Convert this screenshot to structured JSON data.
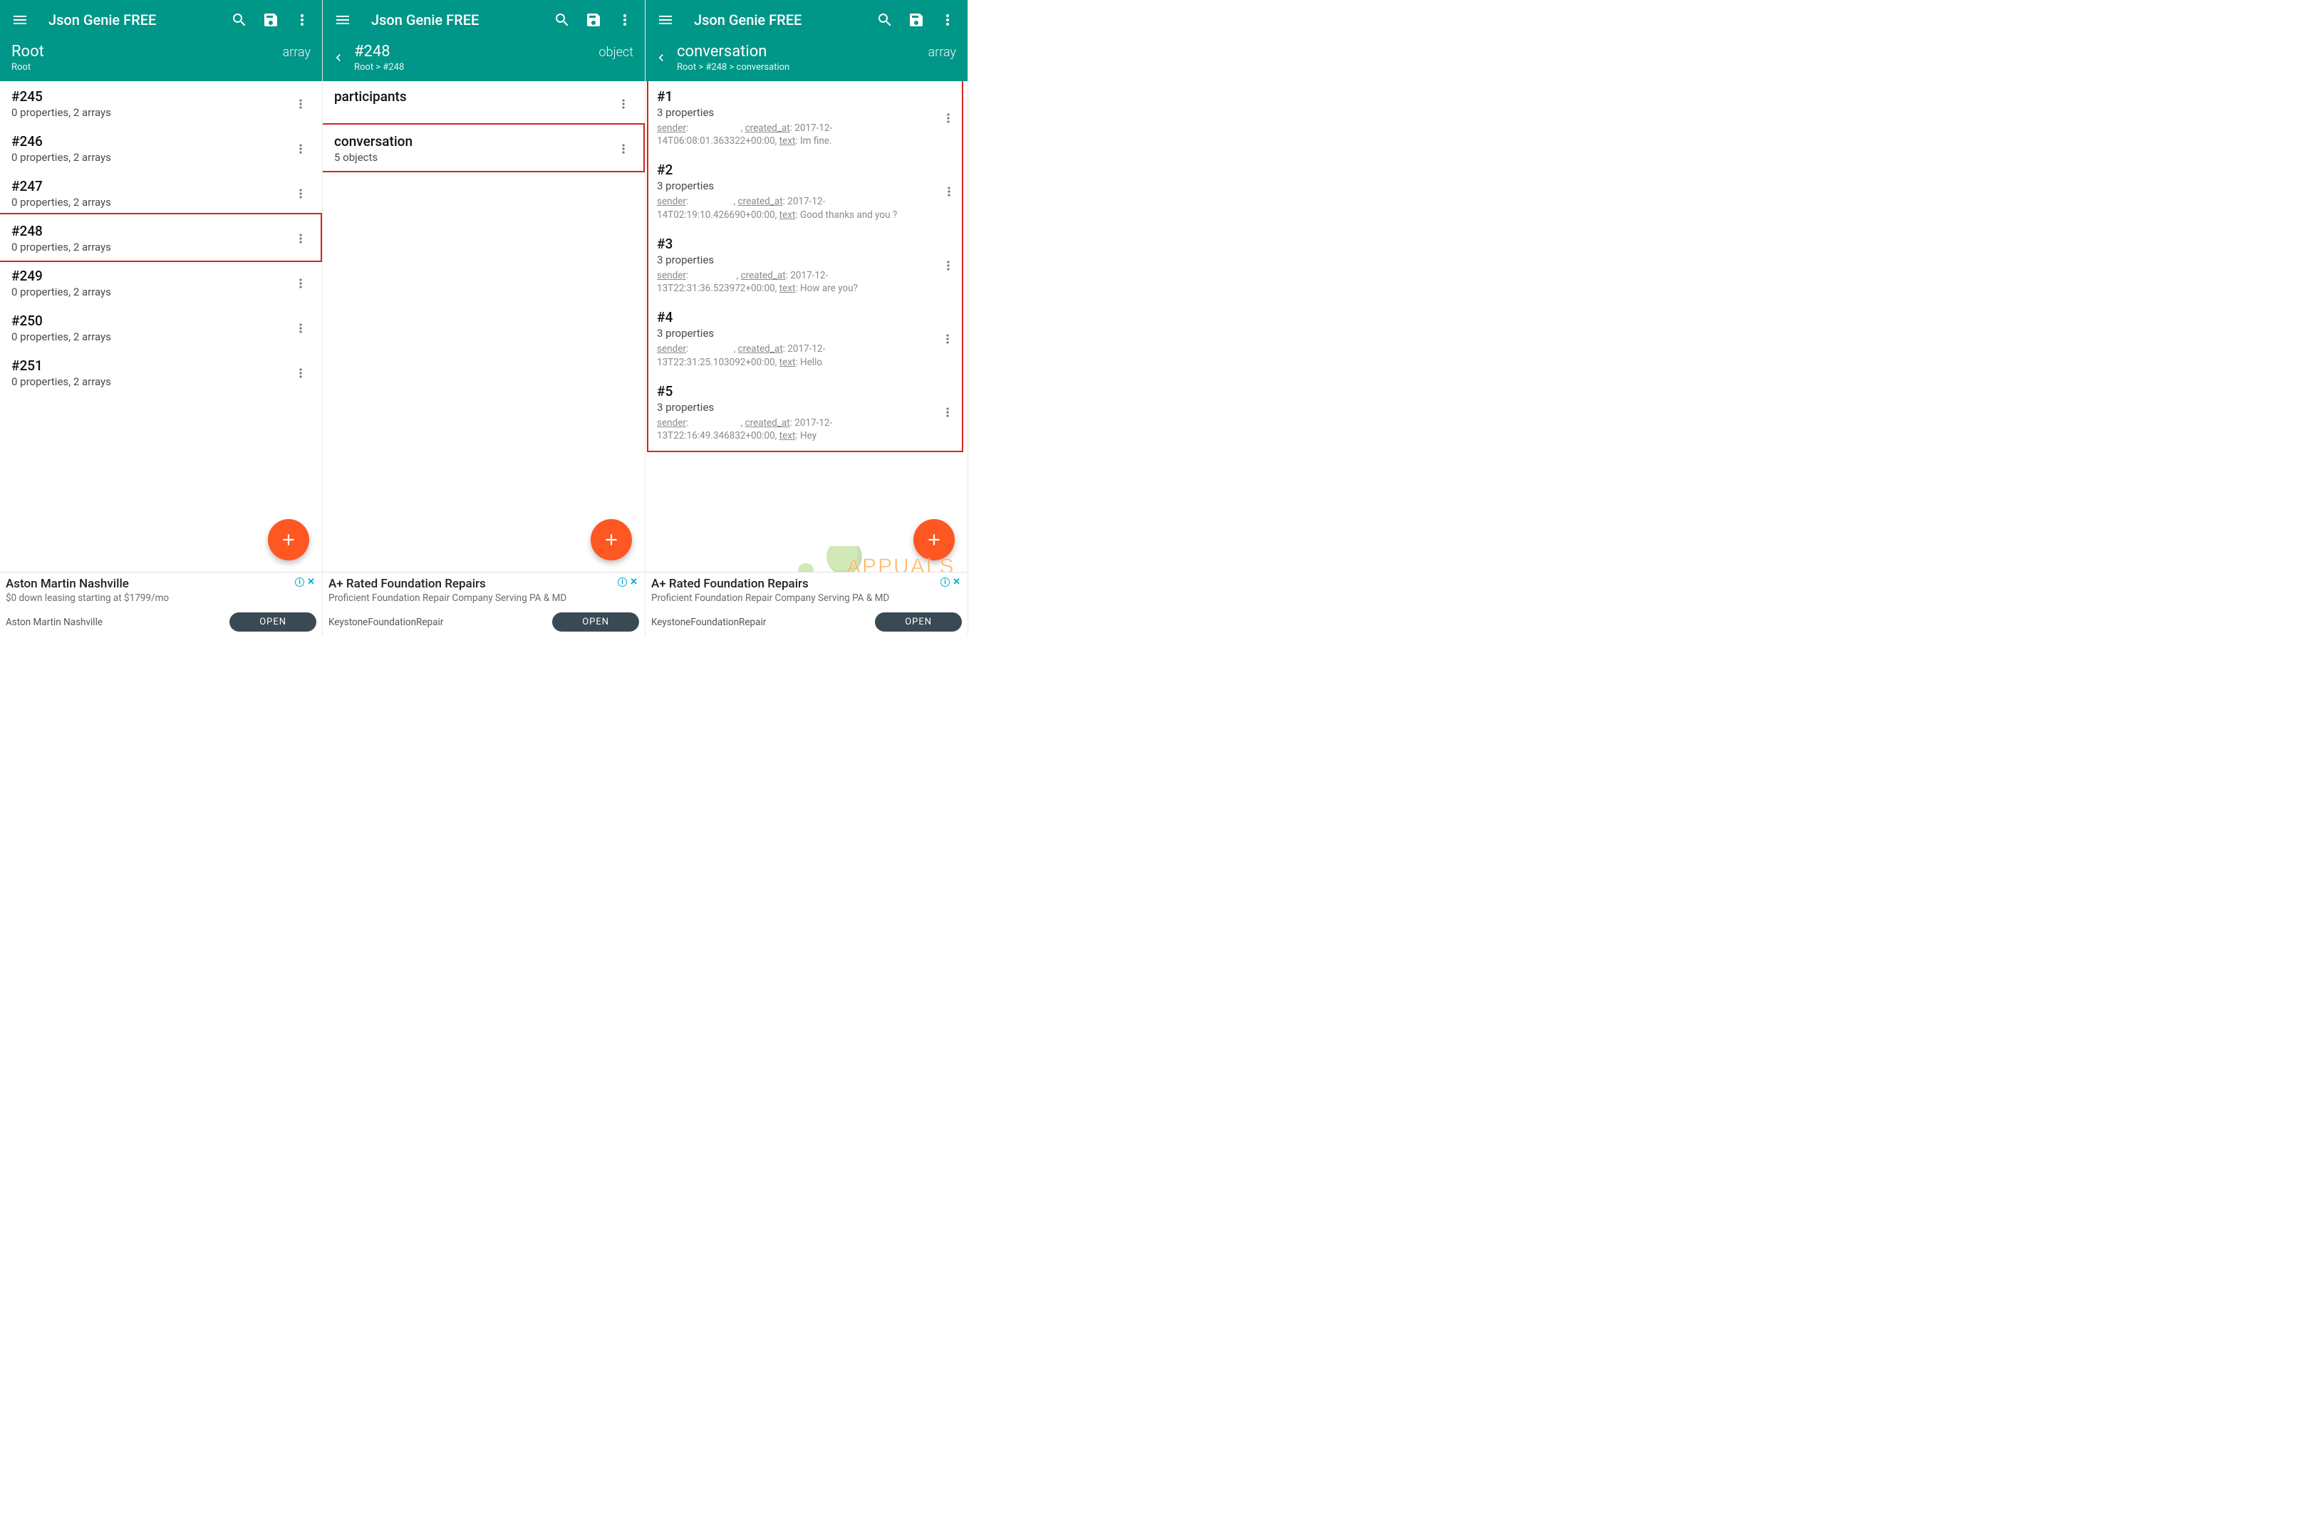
{
  "app": {
    "title": "Json Genie FREE"
  },
  "icons": {
    "menu": "menu-icon",
    "search": "search-icon",
    "save": "save-icon",
    "more": "more-vert-icon",
    "back": "chevron-left-icon",
    "add": "plus-icon"
  },
  "panels": [
    {
      "sub": {
        "title": "Root",
        "type": "array",
        "breadcrumb": "Root",
        "has_back": false
      },
      "items": [
        {
          "title": "#245",
          "sub": "0 properties, 2 arrays"
        },
        {
          "title": "#246",
          "sub": "0 properties, 2 arrays"
        },
        {
          "title": "#247",
          "sub": "0 properties, 2 arrays"
        },
        {
          "title": "#248",
          "sub": "0 properties, 2 arrays"
        },
        {
          "title": "#249",
          "sub": "0 properties, 2 arrays"
        },
        {
          "title": "#250",
          "sub": "0 properties, 2 arrays"
        },
        {
          "title": "#251",
          "sub": "0 properties, 2 arrays"
        }
      ],
      "highlight_index": 3,
      "ad": {
        "title": "Aston Martin Nashville",
        "sub": "$0 down leasing starting at $1799/mo",
        "source": "Aston Martin Nashville",
        "cta": "OPEN"
      }
    },
    {
      "sub": {
        "title": "#248",
        "type": "object",
        "breadcrumb": "Root > #248",
        "has_back": true
      },
      "items": [
        {
          "title": "participants",
          "sub_redacted": true
        },
        {
          "title": "conversation",
          "sub": "5 objects"
        }
      ],
      "highlight_index": 1,
      "ad": {
        "title": "A+ Rated Foundation Repairs",
        "sub": "Proficient Foundation Repair Company Serving PA & MD",
        "source": "KeystoneFoundationRepair",
        "cta": "OPEN"
      }
    },
    {
      "sub": {
        "title": "conversation",
        "type": "array",
        "breadcrumb": "Root > #248 > conversation",
        "has_back": true
      },
      "items": [
        {
          "title": "#1",
          "sub": "3 properties",
          "detail": {
            "sender_redacted": true,
            "created_at": "2017-12-14T06:08:01.363322+00:00",
            "text": "Im fine."
          }
        },
        {
          "title": "#2",
          "sub": "3 properties",
          "detail": {
            "sender_redacted": true,
            "created_at": "2017-12-14T02:19:10.426690+00:00",
            "text": "Good thanks and you ?"
          }
        },
        {
          "title": "#3",
          "sub": "3 properties",
          "detail": {
            "sender_redacted": true,
            "created_at": "2017-12-13T22:31:36.523972+00:00",
            "text": "How are you?"
          }
        },
        {
          "title": "#4",
          "sub": "3 properties",
          "detail": {
            "sender_redacted": true,
            "created_at": "2017-12-13T22:31:25.103092+00:00",
            "text": "Hello"
          }
        },
        {
          "title": "#5",
          "sub": "3 properties",
          "detail": {
            "sender_redacted": true,
            "created_at": "2017-12-13T22:16:49.346832+00:00",
            "text": "Hey"
          }
        }
      ],
      "highlight_all": true,
      "ad": {
        "title": "A+ Rated Foundation Repairs",
        "sub": "Proficient Foundation Repair Company Serving PA & MD",
        "source": "KeystoneFoundationRepair",
        "cta": "OPEN"
      },
      "watermark": "APPUALS"
    }
  ],
  "labels": {
    "sender": "sender",
    "created_at": "created_at",
    "text": "text",
    "colon": ": ",
    "comma": ", "
  }
}
